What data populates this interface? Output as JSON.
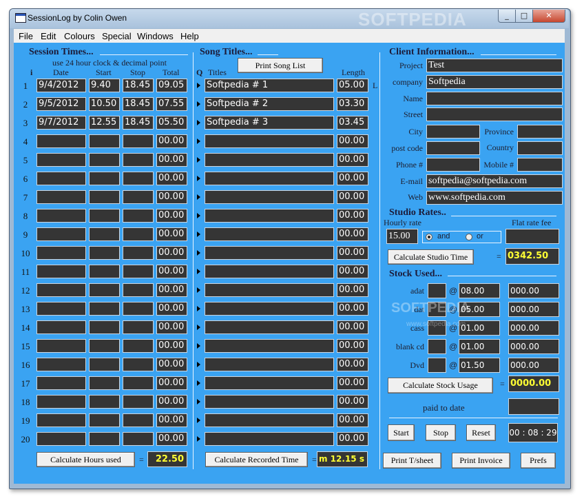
{
  "window": {
    "title": "SessionLog by Colin Owen",
    "controls": [
      "_",
      "□",
      "✕"
    ]
  },
  "watermark": {
    "title_bar": "SOFTPEDIA",
    "center": "SOFTPEDIA",
    "center_url": "www.softpedia.com"
  },
  "menu": [
    "File",
    "Edit",
    "Colours",
    "Special",
    "Windows",
    "Help"
  ],
  "session": {
    "heading": "Session Times...",
    "hint": "use 24 hour clock &  decimal point",
    "col_i": "i",
    "col_date": "Date",
    "col_start": "Start",
    "col_stop": "Stop",
    "col_total": "Total",
    "rows": [
      {
        "n": "1",
        "date": "9/4/2012",
        "start": "9.40",
        "stop": "18.45",
        "total": "09.05"
      },
      {
        "n": "2",
        "date": "9/5/2012",
        "start": "10.50",
        "stop": "18.45",
        "total": "07.55"
      },
      {
        "n": "3",
        "date": "9/7/2012",
        "start": "12.55",
        "stop": "18.45",
        "total": "05.50"
      },
      {
        "n": "4",
        "date": "",
        "start": "",
        "stop": "",
        "total": "00.00"
      },
      {
        "n": "5",
        "date": "",
        "start": "",
        "stop": "",
        "total": "00.00"
      },
      {
        "n": "6",
        "date": "",
        "start": "",
        "stop": "",
        "total": "00.00"
      },
      {
        "n": "7",
        "date": "",
        "start": "",
        "stop": "",
        "total": "00.00"
      },
      {
        "n": "8",
        "date": "",
        "start": "",
        "stop": "",
        "total": "00.00"
      },
      {
        "n": "9",
        "date": "",
        "start": "",
        "stop": "",
        "total": "00.00"
      },
      {
        "n": "10",
        "date": "",
        "start": "",
        "stop": "",
        "total": "00.00"
      },
      {
        "n": "11",
        "date": "",
        "start": "",
        "stop": "",
        "total": "00.00"
      },
      {
        "n": "12",
        "date": "",
        "start": "",
        "stop": "",
        "total": "00.00"
      },
      {
        "n": "13",
        "date": "",
        "start": "",
        "stop": "",
        "total": "00.00"
      },
      {
        "n": "14",
        "date": "",
        "start": "",
        "stop": "",
        "total": "00.00"
      },
      {
        "n": "15",
        "date": "",
        "start": "",
        "stop": "",
        "total": "00.00"
      },
      {
        "n": "16",
        "date": "",
        "start": "",
        "stop": "",
        "total": "00.00"
      },
      {
        "n": "17",
        "date": "",
        "start": "",
        "stop": "",
        "total": "00.00"
      },
      {
        "n": "18",
        "date": "",
        "start": "",
        "stop": "",
        "total": "00.00"
      },
      {
        "n": "19",
        "date": "",
        "start": "",
        "stop": "",
        "total": "00.00"
      },
      {
        "n": "20",
        "date": "",
        "start": "",
        "stop": "",
        "total": "00.00"
      }
    ],
    "calc_button": "Calculate Hours used",
    "equals": "=",
    "hours_total": "22.50"
  },
  "songs": {
    "heading": "Song Titles...",
    "print_button": "Print Song List",
    "col_q": "Q",
    "col_titles": "Titles",
    "col_length": "Length",
    "side_label": "L",
    "rows": [
      {
        "title": "Softpedia # 1",
        "length": "05.00"
      },
      {
        "title": "Softpedia # 2",
        "length": "03.30"
      },
      {
        "title": "Softpedia # 3",
        "length": "03.45"
      },
      {
        "title": "",
        "length": "00.00"
      },
      {
        "title": "",
        "length": "00.00"
      },
      {
        "title": "",
        "length": "00.00"
      },
      {
        "title": "",
        "length": "00.00"
      },
      {
        "title": "",
        "length": "00.00"
      },
      {
        "title": "",
        "length": "00.00"
      },
      {
        "title": "",
        "length": "00.00"
      },
      {
        "title": "",
        "length": "00.00"
      },
      {
        "title": "",
        "length": "00.00"
      },
      {
        "title": "",
        "length": "00.00"
      },
      {
        "title": "",
        "length": "00.00"
      },
      {
        "title": "",
        "length": "00.00"
      },
      {
        "title": "",
        "length": "00.00"
      },
      {
        "title": "",
        "length": "00.00"
      },
      {
        "title": "",
        "length": "00.00"
      },
      {
        "title": "",
        "length": "00.00"
      },
      {
        "title": "",
        "length": "00.00"
      }
    ],
    "calc_button": "Calculate Recorded Time",
    "equals": "=",
    "recorded_total": "m 12.15 s"
  },
  "client": {
    "heading": "Client Information...",
    "project_label": "Project",
    "project": "Test",
    "company_label": "company",
    "company": "Softpedia",
    "name_label": "Name",
    "name": "",
    "street_label": "Street",
    "street": "",
    "city_label": "City",
    "city": "",
    "province_label": "Province",
    "province": "",
    "postcode_label": "post code",
    "postcode": "",
    "country_label": "Country",
    "country": "",
    "phone_label": "Phone #",
    "phone": "",
    "mobile_label": "Mobile #",
    "mobile": "",
    "email_label": "E-mail",
    "email": "softpedia@softpedia.com",
    "web_label": "Web",
    "web": "www.softpedia.com"
  },
  "rates": {
    "heading": "Studio Rates..",
    "hourly_label": "Hourly rate",
    "hourly": "15.00",
    "and_label": "and",
    "or_label": "or",
    "selected": "and",
    "flat_label": "Flat rate fee",
    "flat": "",
    "calc_button": "Calculate Studio Time",
    "equals": "=",
    "studio_total": "0342.50"
  },
  "stock": {
    "heading": "Stock Used...",
    "at": "@",
    "items": [
      {
        "label": "adat",
        "qty": "",
        "price": "08.00",
        "total": "000.00"
      },
      {
        "label": "dat",
        "qty": "",
        "price": "05.00",
        "total": "000.00"
      },
      {
        "label": "cass",
        "qty": "",
        "price": "01.00",
        "total": "000.00"
      },
      {
        "label": "blank cd",
        "qty": "",
        "price": "01.00",
        "total": "000.00"
      },
      {
        "label": "Dvd",
        "qty": "",
        "price": "01.50",
        "total": "000.00"
      }
    ],
    "calc_button": "Calculate Stock Usage",
    "equals": "=",
    "stock_total": "0000.00",
    "paid_label": "paid to date",
    "paid": ""
  },
  "timer": {
    "start": "Start",
    "stop": "Stop",
    "reset": "Reset",
    "time": "00 : 08 : 29"
  },
  "footer": {
    "print_tsheet": "Print T/sheet",
    "print_invoice": "Print Invoice",
    "prefs": "Prefs"
  }
}
